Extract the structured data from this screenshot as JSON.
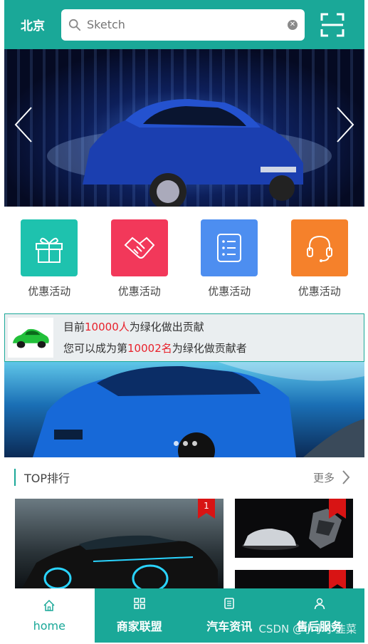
{
  "header": {
    "city": "北京",
    "search_placeholder": "Sketch"
  },
  "categories": [
    {
      "label": "优惠活动",
      "icon": "gift-icon",
      "color": "#1ec2ae"
    },
    {
      "label": "优惠活动",
      "icon": "handshake-icon",
      "color": "#f2385a"
    },
    {
      "label": "优惠活动",
      "icon": "list-icon",
      "color": "#4d8ef0"
    },
    {
      "label": "优惠活动",
      "icon": "headset-icon",
      "color": "#f5812b"
    }
  ],
  "notice": {
    "line1_pre": "目前",
    "line1_num": "10000人",
    "line1_post": "为绿化做出贡献",
    "line2_pre": "您可以成为第",
    "line2_num": "10002名",
    "line2_post": "为绿化做贡献者"
  },
  "ranking": {
    "title": "TOP排行",
    "more": "更多",
    "rank1": "1"
  },
  "tabs": [
    {
      "label": "home",
      "icon": "home-icon"
    },
    {
      "label": "商家联盟",
      "icon": "grid-icon"
    },
    {
      "label": "汽车资讯",
      "icon": "document-icon"
    },
    {
      "label": "售后服务",
      "icon": "user-icon"
    }
  ],
  "watermark": "CSDN @小小小韭菜",
  "colors": {
    "primary": "#1aa898",
    "highlight": "#e8212b"
  }
}
